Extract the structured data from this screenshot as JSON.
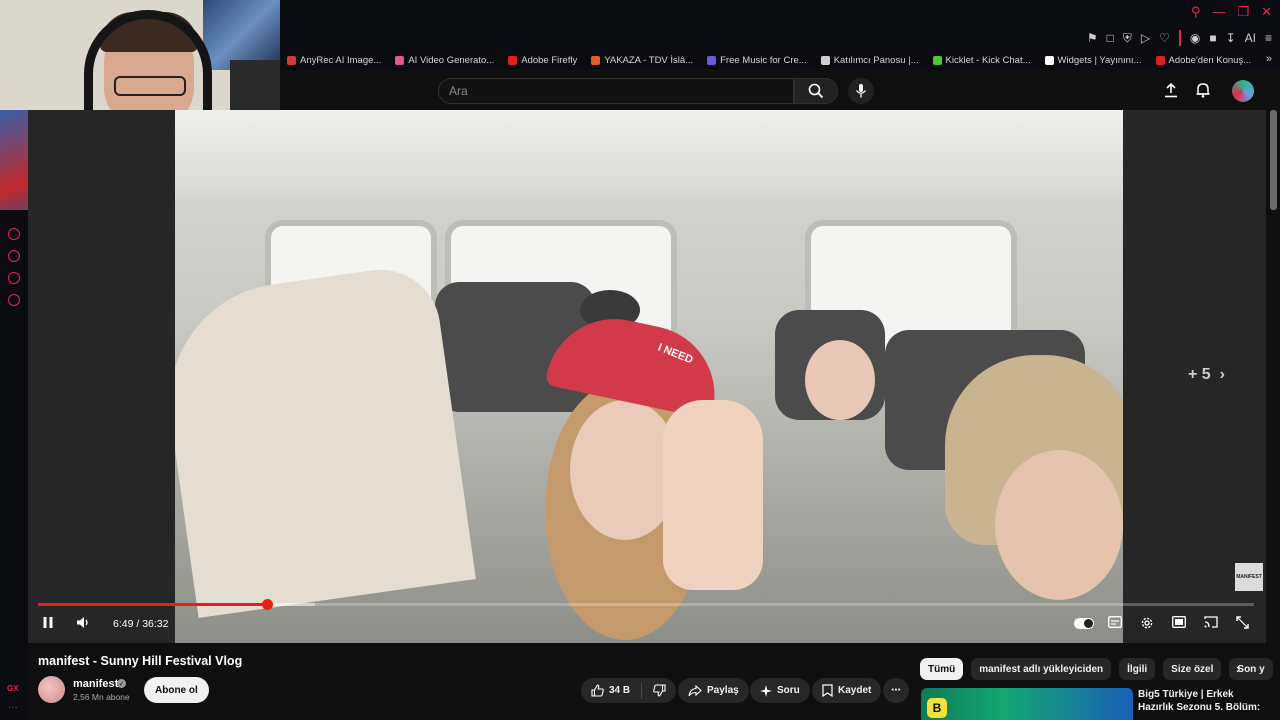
{
  "browser": {
    "bookmarks": [
      {
        "label": "AnyRec AI Image...",
        "color": "#d23a3a"
      },
      {
        "label": "AI Video Generato...",
        "color": "#e05a8a"
      },
      {
        "label": "Adobe Firefly",
        "color": "#e02020"
      },
      {
        "label": "YAKAZA - TDV İslâ...",
        "color": "#e0602a"
      },
      {
        "label": "Free Music for Cre...",
        "color": "#6a5ae0"
      },
      {
        "label": "Katılımcı Panosu |...",
        "color": "#cfcfcf"
      },
      {
        "label": "Kicklet - Kick Chat...",
        "color": "#53c43a"
      },
      {
        "label": "Widgets | Yayınını...",
        "color": "#ffffff"
      },
      {
        "label": "Adobe'den Konuş...",
        "color": "#e02020"
      }
    ],
    "toolbar_ai_label": "AI"
  },
  "header": {
    "search_placeholder": "Ara"
  },
  "player": {
    "time_display": "6:49 / 36:32",
    "more_videos_label": "+ 5",
    "watermark_text": "MANIFEST",
    "progress_played_fraction": 0.188,
    "progress_loaded_fraction": 0.228,
    "cap_text": "I NEED"
  },
  "video": {
    "title": "manifest - Sunny Hill Festival Vlog",
    "channel_name": "manifest",
    "subscribers": "2,56 Mn abone",
    "subscribe_label": "Abone ol",
    "like_count": "34 B",
    "share_label": "Paylaş",
    "ask_label": "Soru",
    "save_label": "Kaydet"
  },
  "sidebar": {
    "chips": [
      "Tümü",
      "manifest adlı yükleyiciden",
      "İlgili",
      "Size özel",
      "Son y"
    ],
    "recommendation": {
      "title": "Big5 Türkiye | Erkek Hazırlık Sezonu 5. Bölüm:",
      "badge": "B"
    }
  },
  "rail": {
    "gx_label": "GX",
    "dots_label": "···"
  },
  "colors": {
    "accent": "#e0294a",
    "progress": "#e62117",
    "background": "#0f0f0f"
  }
}
